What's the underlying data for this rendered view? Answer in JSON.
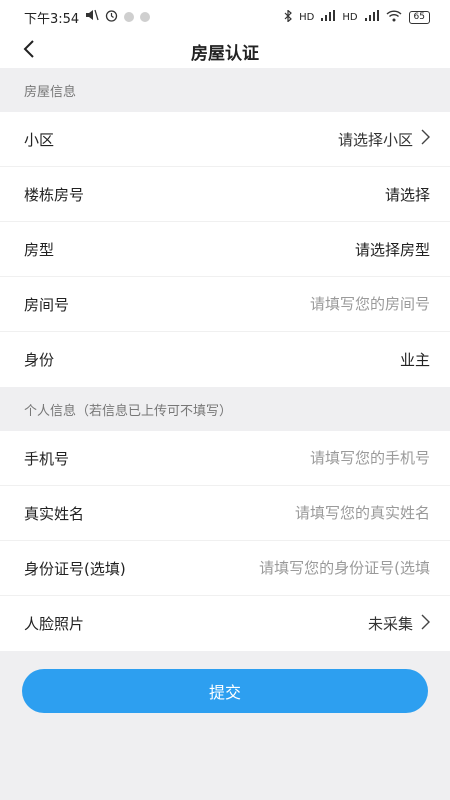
{
  "status_bar": {
    "time": "下午3:54",
    "battery": "65",
    "network_1": "HD",
    "network_2": "HD"
  },
  "header": {
    "title": "房屋认证"
  },
  "sections": {
    "house": {
      "title": "房屋信息",
      "rows": {
        "community": {
          "label": "小区",
          "value": "请选择小区"
        },
        "building": {
          "label": "楼栋房号",
          "value": "请选择"
        },
        "house_type": {
          "label": "房型",
          "value": "请选择房型"
        },
        "room_no": {
          "label": "房间号",
          "placeholder": "请填写您的房间号"
        },
        "identity": {
          "label": "身份",
          "value": "业主"
        }
      }
    },
    "personal": {
      "title": "个人信息（若信息已上传可不填写）",
      "rows": {
        "phone": {
          "label": "手机号",
          "placeholder": "请填写您的手机号"
        },
        "name": {
          "label": "真实姓名",
          "placeholder": "请填写您的真实姓名"
        },
        "id_no": {
          "label": "身份证号(选填)",
          "placeholder": "请填写您的身份证号(选填"
        },
        "face_photo": {
          "label": "人脸照片",
          "value": "未采集"
        }
      }
    }
  },
  "submit_label": "提交",
  "colors": {
    "accent": "#2d9ff0",
    "background": "#efeff1"
  },
  "icons": {
    "back": "chevron-left-icon",
    "row_arrow": "chevron-right-icon"
  }
}
